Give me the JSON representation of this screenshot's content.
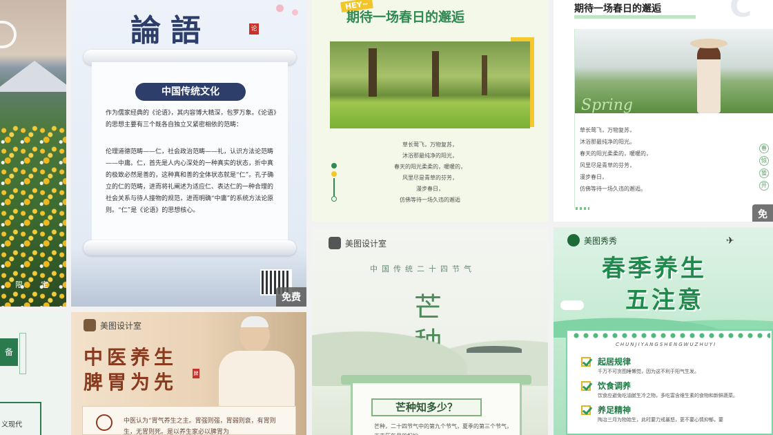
{
  "colors": {
    "green_accent": "#2f8a52",
    "navy": "#2d3e6b",
    "tcm_brown": "#8a3a1e",
    "mint": "#7fd3a4"
  },
  "cards": {
    "landscape": {
      "footer_chars": [
        "限",
        "定"
      ]
    },
    "lunyu": {
      "title": "論語",
      "seal": "论",
      "banner": "中国传统文化",
      "para1": "作为儒家经典的《论语》，其内容博大精深，包罗万象。《论语》的思想主要有三个既各自独立又紧密相依的范畴：",
      "para2": "伦理道德范畴——仁，社会政治范畴——礼，认识方法论范畴——中庸。仁，首先是人内心深处的一种真实的状态，折中真的极致必然是善的，这种真和善的全体状态就是“仁”。孔子确立的仁的范畴，进而将礼阐述为适应仁、表达仁的一种合理的社会关系与待人接物的规范，进而明确“中庸”的系统方法论原则。“仁”是《论语》的思想核心。",
      "free": "免费"
    },
    "spring1": {
      "hey": "HEY~",
      "title": "期待一场春日的邂逅",
      "lines": [
        "草长莺飞，万物复苏，",
        "沐浴那最纯净的阳光，",
        "春天的阳光柔柔的，暖暖的，",
        "风里尽是青草的芬芳，",
        "漫步春日，",
        "仿佛等待一场久违的邂逅"
      ]
    },
    "spring2": {
      "title": "期待一场春日的邂逅",
      "spring_word": "Spring",
      "lines": [
        "草长莺飞，万物复苏，",
        "沐浴那最纯净的阳光。",
        "春天的阳光柔柔的，暖暖的，",
        "风里尽是青草的芬芳，",
        "漫步春日，",
        "仿佛等待一场久违的邂逅。"
      ],
      "side_chars": [
        "春",
        "惊",
        "蛰",
        "开"
      ],
      "free": "免"
    },
    "left_bottom": {
      "block_char": "备",
      "text": "义现代"
    },
    "tcm": {
      "brand": "美图设计室",
      "title1": "中医养生",
      "title2": "脾胃为先",
      "seal": "脾",
      "body": "中医认为“胃气养生之主。胃强则强，胃弱则衰，有胃则生，无胃则死。是以养生家必以脾胃为"
    },
    "mangzhong": {
      "brand": "美图设计室",
      "subtitle": "中国传统二十四节气",
      "char1": "芒",
      "char2": "种",
      "banner": "芒种知多少？",
      "body": "芒种，二十四节气中的第九个节气，夏季的第三个节气，干支历午月的起始。"
    },
    "chunji": {
      "brand": "美图秀秀",
      "title1": "春季养生",
      "title2": "五注意",
      "pinyin": "CHUNJIYANGSHENGWUZHUYI",
      "items": [
        {
          "title": "起居规律",
          "desc": "千万不可贪图睡懒觉，因为这不利于阳气生发。"
        },
        {
          "title": "饮食调养",
          "desc": "饮食应避免吃油腻生冷之物，多吃富含维生素的食物和新鲜蔬菜。"
        },
        {
          "title": "养足精神",
          "desc": "陶冶三月为物始生，此时要力戒暴怒，更不要心情抑郁，要"
        }
      ]
    }
  }
}
